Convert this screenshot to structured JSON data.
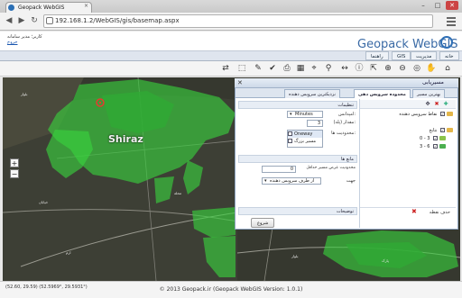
{
  "browser": {
    "tab_title": "Geopack WebGIS",
    "url": "192.168.1.2/WebGIS/gis/basemap.aspx",
    "tab_close": "×",
    "win_minimize": "–",
    "win_maximize": "□",
    "win_close": "✕",
    "back": "◀",
    "forward": "▶",
    "reload": "↻"
  },
  "header": {
    "welcome": "کاربر؛ مدیر سامانه",
    "logout": "خروج",
    "logo": "Geopack WebGIS"
  },
  "menu": {
    "items": [
      "خانه",
      "مدیریت",
      "GIS",
      "راهنما"
    ]
  },
  "map": {
    "city_label": "Shiraz",
    "zoom_in": "+",
    "zoom_out": "−"
  },
  "panel": {
    "title": "مسیریابی",
    "close": "✕",
    "tabs": [
      "نزدیکترین سرویس دهنده",
      "محدوده سرویس دهی",
      "بهترین مسیر"
    ],
    "active_tab": 1,
    "settings": {
      "section_title": "تنظیمات",
      "impedance_label": "امپدانس:",
      "impedance_value": "Minutes",
      "range_label": "مقدار (پله):",
      "range_value": "3",
      "restrictions_label": "محدودیت ها:",
      "restriction_options": [
        "Oneway",
        "مسیر بزرگ"
      ]
    },
    "barriers": {
      "section_title": "مانع ها",
      "fields": [
        {
          "label": "محدودیت عرض مسیر حداقل",
          "value": "0"
        },
        {
          "label": "جهت",
          "value": "از طرف سرویس دهنده"
        }
      ]
    },
    "description_title": "توضیحات",
    "submit_button": "شروع",
    "layers": {
      "items": [
        {
          "label": "نقاط سرویس دهنده",
          "checked": true,
          "indent": 0
        },
        {
          "label": "نتایج",
          "checked": true,
          "indent": 0
        },
        {
          "label": "0 - 3",
          "checked": true,
          "indent": 1
        },
        {
          "label": "3 - 6",
          "checked": true,
          "indent": 1
        }
      ],
      "footer": "حذف نقطه"
    }
  },
  "status": {
    "coords": "(52.60, 29.59) (52.5969°, 29.5931°)",
    "copyright": "© 2013 Geopack.ir (Geopack WebGIS Version: 1.0.1)"
  },
  "colors": {
    "accent": "#3a6aa5",
    "service_area": "#39d33d",
    "map_dark": "#34362f"
  }
}
